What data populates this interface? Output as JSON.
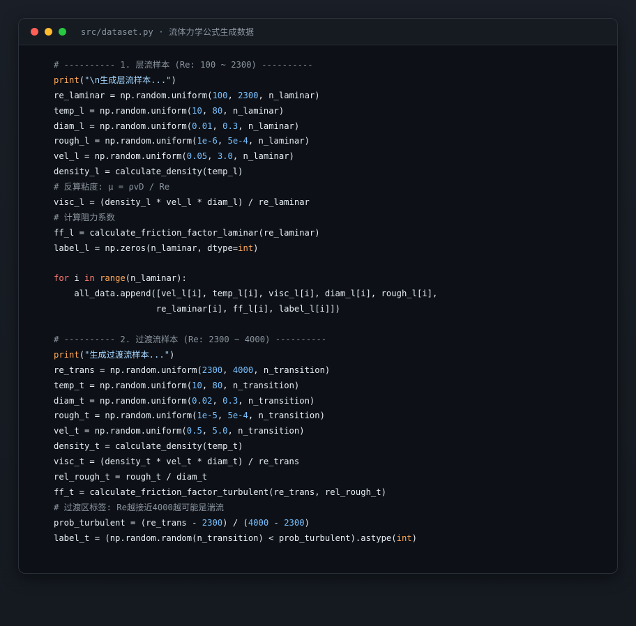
{
  "window": {
    "title": "src/dataset.py · 流体力学公式生成数据"
  },
  "colors": {
    "background": "#0d1117",
    "comment": "#8b949e",
    "keyword": "#ff7b72",
    "builtin": "#ffa657",
    "string": "#a5d6ff",
    "number": "#79c0ff",
    "plain": "#e6edf3"
  },
  "code": {
    "language": "python",
    "lines": [
      [
        [
          "comment",
          "# ---------- 1. 层流样本 (Re: 100 ~ 2300) ----------"
        ]
      ],
      [
        [
          "builtin",
          "print"
        ],
        [
          "plain",
          "("
        ],
        [
          "string",
          "\"\\n生成层流样本...\""
        ],
        [
          "plain",
          ")"
        ]
      ],
      [
        [
          "plain",
          "re_laminar = np.random.uniform("
        ],
        [
          "number",
          "100"
        ],
        [
          "plain",
          ", "
        ],
        [
          "number",
          "2300"
        ],
        [
          "plain",
          ", n_laminar)"
        ]
      ],
      [
        [
          "plain",
          "temp_l = np.random.uniform("
        ],
        [
          "number",
          "10"
        ],
        [
          "plain",
          ", "
        ],
        [
          "number",
          "80"
        ],
        [
          "plain",
          ", n_laminar)"
        ]
      ],
      [
        [
          "plain",
          "diam_l = np.random.uniform("
        ],
        [
          "number",
          "0.01"
        ],
        [
          "plain",
          ", "
        ],
        [
          "number",
          "0.3"
        ],
        [
          "plain",
          ", n_laminar)"
        ]
      ],
      [
        [
          "plain",
          "rough_l = np.random.uniform("
        ],
        [
          "number",
          "1e-6"
        ],
        [
          "plain",
          ", "
        ],
        [
          "number",
          "5e-4"
        ],
        [
          "plain",
          ", n_laminar)"
        ]
      ],
      [
        [
          "plain",
          "vel_l = np.random.uniform("
        ],
        [
          "number",
          "0.05"
        ],
        [
          "plain",
          ", "
        ],
        [
          "number",
          "3.0"
        ],
        [
          "plain",
          ", n_laminar)"
        ]
      ],
      [
        [
          "plain",
          "density_l = calculate_density(temp_l)"
        ]
      ],
      [
        [
          "comment",
          "# 反算粘度: μ = ρvD / Re"
        ]
      ],
      [
        [
          "plain",
          "visc_l = (density_l * vel_l * diam_l) / re_laminar"
        ]
      ],
      [
        [
          "comment",
          "# 计算阻力系数"
        ]
      ],
      [
        [
          "plain",
          "ff_l = calculate_friction_factor_laminar(re_laminar)"
        ]
      ],
      [
        [
          "plain",
          "label_l = np.zeros(n_laminar, dtype="
        ],
        [
          "builtin",
          "int"
        ],
        [
          "plain",
          ")"
        ]
      ],
      [],
      [
        [
          "keyword",
          "for"
        ],
        [
          "plain",
          " i "
        ],
        [
          "keyword",
          "in"
        ],
        [
          "plain",
          " "
        ],
        [
          "builtin",
          "range"
        ],
        [
          "plain",
          "(n_laminar):"
        ]
      ],
      [
        [
          "plain",
          "    all_data.append([vel_l[i], temp_l[i], visc_l[i], diam_l[i], rough_l[i],"
        ]
      ],
      [
        [
          "plain",
          "                    re_laminar[i], ff_l[i], label_l[i]])"
        ]
      ],
      [],
      [
        [
          "comment",
          "# ---------- 2. 过渡流样本 (Re: 2300 ~ 4000) ----------"
        ]
      ],
      [
        [
          "builtin",
          "print"
        ],
        [
          "plain",
          "("
        ],
        [
          "string",
          "\"生成过渡流样本...\""
        ],
        [
          "plain",
          ")"
        ]
      ],
      [
        [
          "plain",
          "re_trans = np.random.uniform("
        ],
        [
          "number",
          "2300"
        ],
        [
          "plain",
          ", "
        ],
        [
          "number",
          "4000"
        ],
        [
          "plain",
          ", n_transition)"
        ]
      ],
      [
        [
          "plain",
          "temp_t = np.random.uniform("
        ],
        [
          "number",
          "10"
        ],
        [
          "plain",
          ", "
        ],
        [
          "number",
          "80"
        ],
        [
          "plain",
          ", n_transition)"
        ]
      ],
      [
        [
          "plain",
          "diam_t = np.random.uniform("
        ],
        [
          "number",
          "0.02"
        ],
        [
          "plain",
          ", "
        ],
        [
          "number",
          "0.3"
        ],
        [
          "plain",
          ", n_transition)"
        ]
      ],
      [
        [
          "plain",
          "rough_t = np.random.uniform("
        ],
        [
          "number",
          "1e-5"
        ],
        [
          "plain",
          ", "
        ],
        [
          "number",
          "5e-4"
        ],
        [
          "plain",
          ", n_transition)"
        ]
      ],
      [
        [
          "plain",
          "vel_t = np.random.uniform("
        ],
        [
          "number",
          "0.5"
        ],
        [
          "plain",
          ", "
        ],
        [
          "number",
          "5.0"
        ],
        [
          "plain",
          ", n_transition)"
        ]
      ],
      [
        [
          "plain",
          "density_t = calculate_density(temp_t)"
        ]
      ],
      [
        [
          "plain",
          "visc_t = (density_t * vel_t * diam_t) / re_trans"
        ]
      ],
      [
        [
          "plain",
          "rel_rough_t = rough_t / diam_t"
        ]
      ],
      [
        [
          "plain",
          "ff_t = calculate_friction_factor_turbulent(re_trans, rel_rough_t)"
        ]
      ],
      [
        [
          "comment",
          "# 过渡区标签: Re越接近4000越可能是湍流"
        ]
      ],
      [
        [
          "plain",
          "prob_turbulent = (re_trans - "
        ],
        [
          "number",
          "2300"
        ],
        [
          "plain",
          ") / ("
        ],
        [
          "number",
          "4000"
        ],
        [
          "plain",
          " - "
        ],
        [
          "number",
          "2300"
        ],
        [
          "plain",
          ")"
        ]
      ],
      [
        [
          "plain",
          "label_t = (np.random.random(n_transition) < prob_turbulent).astype("
        ],
        [
          "builtin",
          "int"
        ],
        [
          "plain",
          ")"
        ]
      ]
    ]
  }
}
